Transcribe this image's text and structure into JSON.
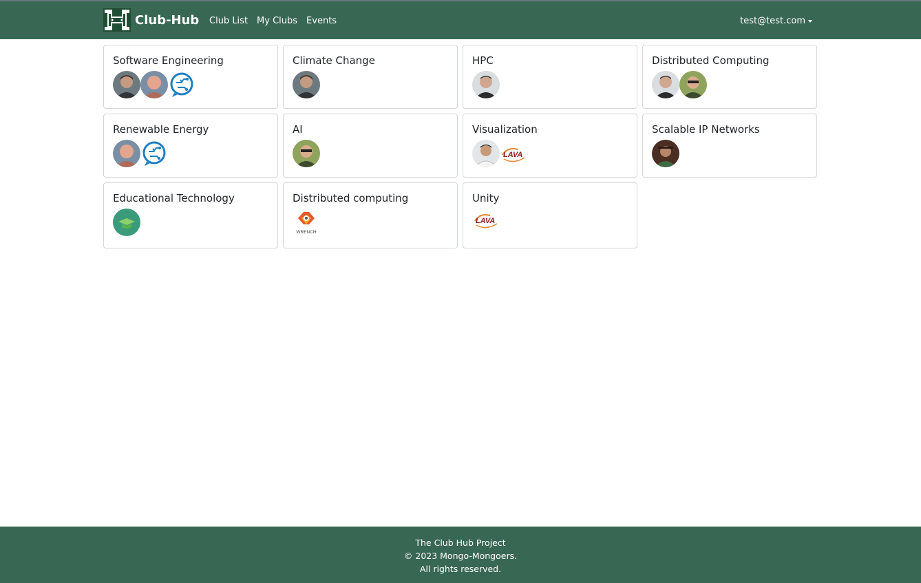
{
  "navbar": {
    "brand": "Club-Hub",
    "links": [
      "Club List",
      "My Clubs",
      "Events"
    ],
    "user": "test@test.com",
    "color": "#386753"
  },
  "clubs": [
    {
      "title": "Software Engineering",
      "avatars": [
        "person-photo",
        "person-photo",
        "circuit-chat-logo"
      ]
    },
    {
      "title": "Climate Change",
      "avatars": [
        "person-photo"
      ]
    },
    {
      "title": "HPC",
      "avatars": [
        "person-photo"
      ]
    },
    {
      "title": "Distributed Computing",
      "avatars": [
        "person-photo",
        "person-photo"
      ]
    },
    {
      "title": "Renewable Energy",
      "avatars": [
        "person-photo",
        "circuit-chat-logo"
      ]
    },
    {
      "title": "AI",
      "avatars": [
        "person-photo"
      ]
    },
    {
      "title": "Visualization",
      "avatars": [
        "person-photo",
        "lava-logo"
      ]
    },
    {
      "title": "Scalable IP Networks",
      "avatars": [
        "person-photo"
      ]
    },
    {
      "title": "Educational Technology",
      "avatars": [
        "graduation-cap-logo"
      ]
    },
    {
      "title": "Distributed computing",
      "avatars": [
        "wrench-logo"
      ]
    },
    {
      "title": "Unity",
      "avatars": [
        "lava-logo"
      ]
    }
  ],
  "logo_text": {
    "lava": "LAVA",
    "wrench": "WRENCH"
  },
  "footer": {
    "line1": "The Club Hub Project",
    "line2": "© 2023 Mongo-Mongoers.",
    "line3": "All rights reserved."
  }
}
